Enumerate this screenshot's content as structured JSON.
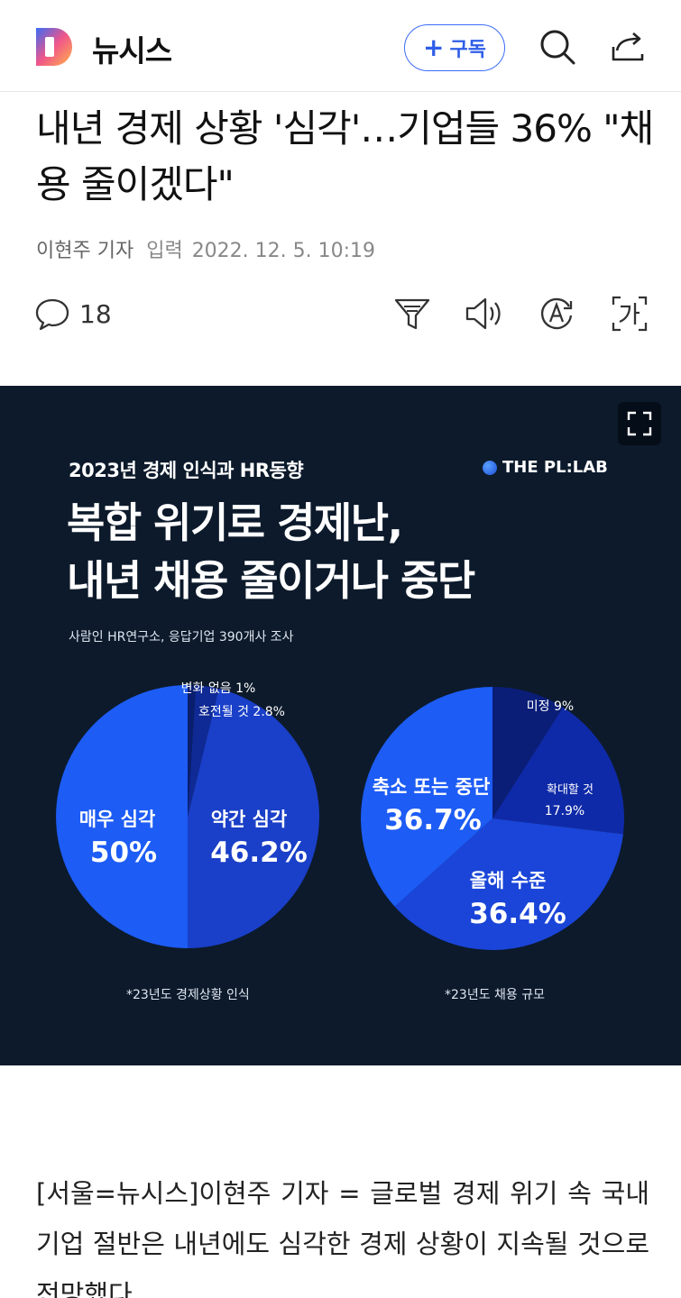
{
  "header": {
    "brand": "뉴시스",
    "subscribe_label": "구독",
    "icons": [
      "logo-icon",
      "search-icon",
      "share-icon"
    ]
  },
  "article": {
    "headline": "내년 경제 상황 '심각'…기업들 36% \"채용 줄이겠다\"",
    "reporter": "이현주 기자",
    "input_label": "입력",
    "date": "2022. 12. 5. 10:19",
    "comment_count": "18",
    "body": "[서울=뉴시스]이현주 기자 = 글로벌 경제 위기 속 국내 기업 절반은 내년에도 심각한 경제 상황이 지속될 것으로 전망했다."
  },
  "tools": [
    "comment-icon",
    "summary-icon",
    "audio-icon",
    "translate-icon",
    "font-size-icon"
  ],
  "infographic": {
    "subtitle": "2023년 경제 인식과 HR동향",
    "brand": "THE PL:LAB",
    "title_line1": "복합 위기로 경제난,",
    "title_line2": "내년 채용 줄이거나 중단",
    "source": "사람인 HR연구소, 응답기업 390개사 조사",
    "note_left": "*23년도 경제상황 인식",
    "note_right": "*23년도 채용 규모"
  },
  "chart_data": [
    {
      "type": "pie",
      "labels": [
        "매우 심각",
        "약간 심각",
        "호전될 것",
        "변화 없음"
      ],
      "values": [
        50,
        46.2,
        2.8,
        1
      ],
      "value_labels": [
        "50%",
        "46.2%",
        "2.8%",
        "1%"
      ],
      "colors": [
        "#1d5cf5",
        "#1a3fc8",
        "#0f2a95",
        "#0a1e6e"
      ]
    },
    {
      "type": "pie",
      "labels": [
        "미정",
        "확대할 것",
        "올해 수준",
        "축소 또는 중단"
      ],
      "values": [
        9,
        17.9,
        36.4,
        36.7
      ],
      "value_labels": [
        "9%",
        "17.9%",
        "36.4%",
        "36.7%"
      ],
      "colors": [
        "#0a1e78",
        "#0f2aa8",
        "#1a45d8",
        "#1d5cf5"
      ]
    }
  ]
}
